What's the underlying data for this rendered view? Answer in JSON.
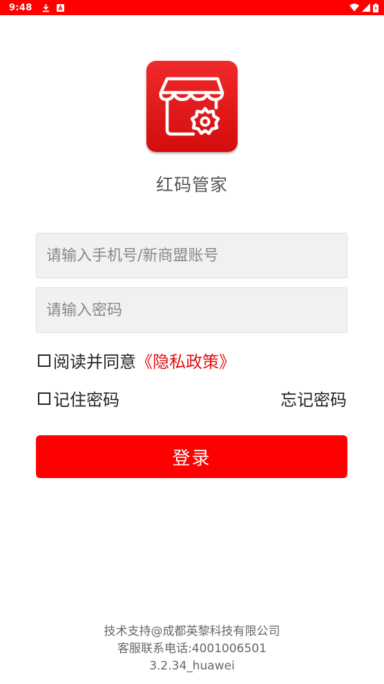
{
  "status_bar": {
    "time": "9:48",
    "left_icons": [
      "download-icon",
      "notification-a-icon"
    ],
    "right_icons": [
      "wifi-icon",
      "signal-icon",
      "battery-icon"
    ],
    "background": "#ff0000"
  },
  "app": {
    "name": "红码管家",
    "logo_icon": "store-settings-icon",
    "brand_color": "#ff0000"
  },
  "form": {
    "phone_placeholder": "请输入手机号/新商盟账号",
    "phone_value": "",
    "password_placeholder": "请输入密码",
    "password_value": "",
    "agree_checked": false,
    "agree_text": "阅读并同意",
    "policy_link": "《隐私政策》",
    "remember_checked": false,
    "remember_label": "记住密码",
    "forgot_label": "忘记密码",
    "login_label": "登录"
  },
  "footer": {
    "support": "技术支持@成都英黎科技有限公司",
    "service": "客服联系电话:4001006501",
    "version": "3.2.34_huawei"
  }
}
